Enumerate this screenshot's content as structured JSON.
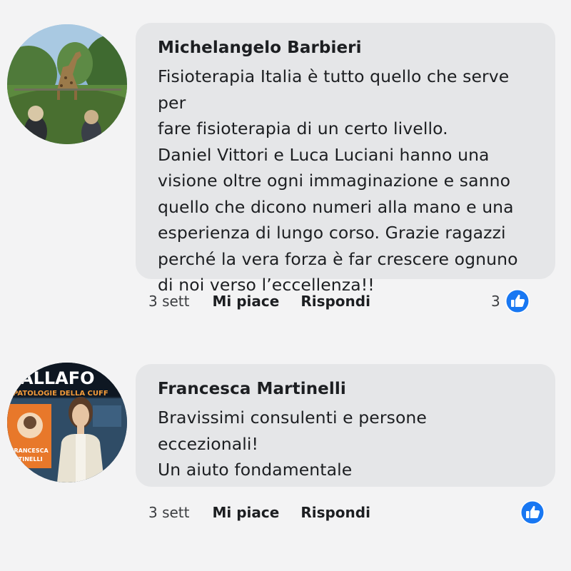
{
  "comments": [
    {
      "author": "Michelangelo Barbieri",
      "text": "Fisioterapia Italia è tutto quello che serve per\nfare fisioterapia di un certo livello.\nDaniel Vittori e Luca Luciani hanno una\nvisione oltre ogni immaginazione e sanno\nquello che dicono numeri alla mano e una\nesperienza di lungo corso. Grazie ragazzi\nperché la vera forza è far crescere ognuno\ndi noi verso l’eccellenza!!",
      "time": "3 sett",
      "like_label": "Mi piace",
      "reply_label": "Rispondi",
      "reaction_count": "3",
      "reaction_icon": "thumbs-up-icon"
    },
    {
      "author": "Francesca Martinelli",
      "text": "Bravissimi consulenti e persone\neccezionali!\nUn aiuto fondamentale",
      "time": "3 sett",
      "like_label": "Mi piace",
      "reply_label": "Rispondi",
      "reaction_count": "",
      "reaction_icon": "thumbs-up-icon"
    }
  ],
  "avatar_text": {
    "banner_top": "ALLAFO",
    "banner_sub": "PATOLOGIE DELLA CUFF",
    "name_tag_1": "FRANCESCA",
    "name_tag_2": "RTINELLI"
  },
  "colors": {
    "bubble": "#e5e6e8",
    "background": "#f3f3f4",
    "like_blue": "#1877f2"
  }
}
